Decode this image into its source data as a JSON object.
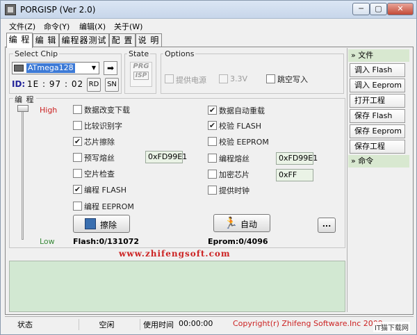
{
  "window": {
    "title": "PORGISP (Ver 2.0)",
    "min_label": "─",
    "max_label": "▢",
    "close_label": "✕"
  },
  "menu": [
    "文件(Z)",
    "命令(Y)",
    "编辑(X)",
    "关于(W)"
  ],
  "tabs": [
    "编 程",
    "编 辑",
    "编程器测试",
    "配 置",
    "说 明"
  ],
  "chip": {
    "group_label": "Select Chip",
    "selected": "ATmega128",
    "id_label": "ID:",
    "id_value": "1E : 97 : 02",
    "rd_label": "RD",
    "sn_label": "SN"
  },
  "state": {
    "group_label": "State",
    "logo_top": "PRG",
    "logo_bottom": "ISP"
  },
  "options": {
    "group_label": "Options",
    "items": [
      {
        "label": "提供电源",
        "checked": false,
        "enabled": false
      },
      {
        "label": "3.3V",
        "checked": false,
        "enabled": false
      },
      {
        "label": "跳空写入",
        "checked": false,
        "enabled": true
      }
    ]
  },
  "program": {
    "group_label": "编 程",
    "high_label": "High",
    "low_label": "Low",
    "left_checks": [
      {
        "label": "数据改变下载",
        "checked": false
      },
      {
        "label": "比较识别字",
        "checked": false
      },
      {
        "label": "芯片擦除",
        "checked": true
      },
      {
        "label": "预写熔丝",
        "checked": false
      },
      {
        "label": "空片检查",
        "checked": false
      },
      {
        "label": "编程 FLASH",
        "checked": true
      },
      {
        "label": "编程 EEPROM",
        "checked": false
      }
    ],
    "right_checks": [
      {
        "label": "数据自动重载",
        "checked": true
      },
      {
        "label": "校验 FLASH",
        "checked": true
      },
      {
        "label": "校验 EEPROM",
        "checked": false
      },
      {
        "label": "编程熔丝",
        "checked": false
      },
      {
        "label": "加密芯片",
        "checked": false
      },
      {
        "label": "提供时钟",
        "checked": false
      }
    ],
    "prewrite_fuse_value": "0xFD99E1",
    "program_fuse_value": "0xFD99E1",
    "lock_value": "0xFF",
    "erase_label": "擦除",
    "auto_label": "自动",
    "more_label": "...",
    "flash_status": "Flash:0/131072",
    "eprom_status": "Eprom:0/4096",
    "url": "www.zhifengsoft.com"
  },
  "sidebar": {
    "file_header": "文件",
    "file_items": [
      "调入 Flash",
      "调入 Eeprom",
      "打开工程",
      "保存 Flash",
      "保存 Eeprom",
      "保存工程"
    ],
    "cmd_header": "命令"
  },
  "statusbar": {
    "state_label": "状态",
    "state_value": "空闲",
    "time_label": "使用时间",
    "time_value": "00:00:00",
    "copyright": "Copyright(r) Zhifeng Software.Inc 2009"
  },
  "watermark": "IT猫下载网",
  "colors": {
    "accent_red": "#cc2222",
    "log_bg": "#d2e8d2",
    "side_highlight": "#d8e8d0"
  }
}
